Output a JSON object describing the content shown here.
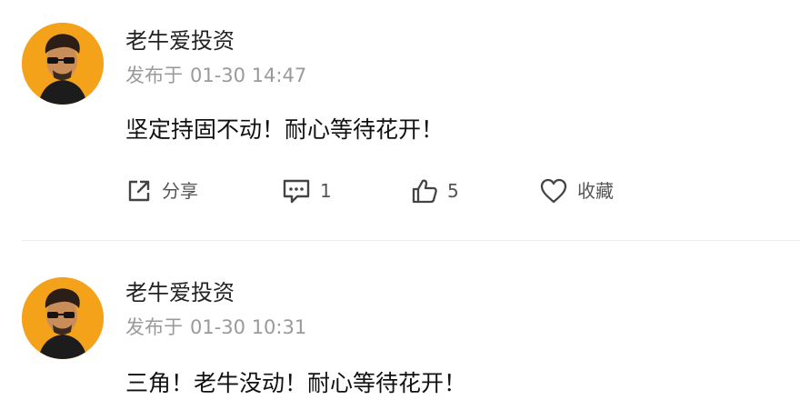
{
  "colors": {
    "avatar_bg": "#f5a21b",
    "text": "#222222",
    "meta": "#9a9a9a",
    "icon": "#444444"
  },
  "posts": [
    {
      "author": "老牛爱投资",
      "published_prefix": "发布于",
      "published_time": "01-30 14:47",
      "content": "坚定持固不动！耐心等待花开！",
      "actions": {
        "share_label": "分享",
        "comment_count": "1",
        "like_count": "5",
        "favorite_label": "收藏"
      },
      "icons": [
        "share-icon",
        "comment-icon",
        "like-icon",
        "favorite-icon"
      ]
    },
    {
      "author": "老牛爱投资",
      "published_prefix": "发布于",
      "published_time": "01-30 10:31",
      "content": "三角！老牛没动！耐心等待花开！"
    }
  ]
}
